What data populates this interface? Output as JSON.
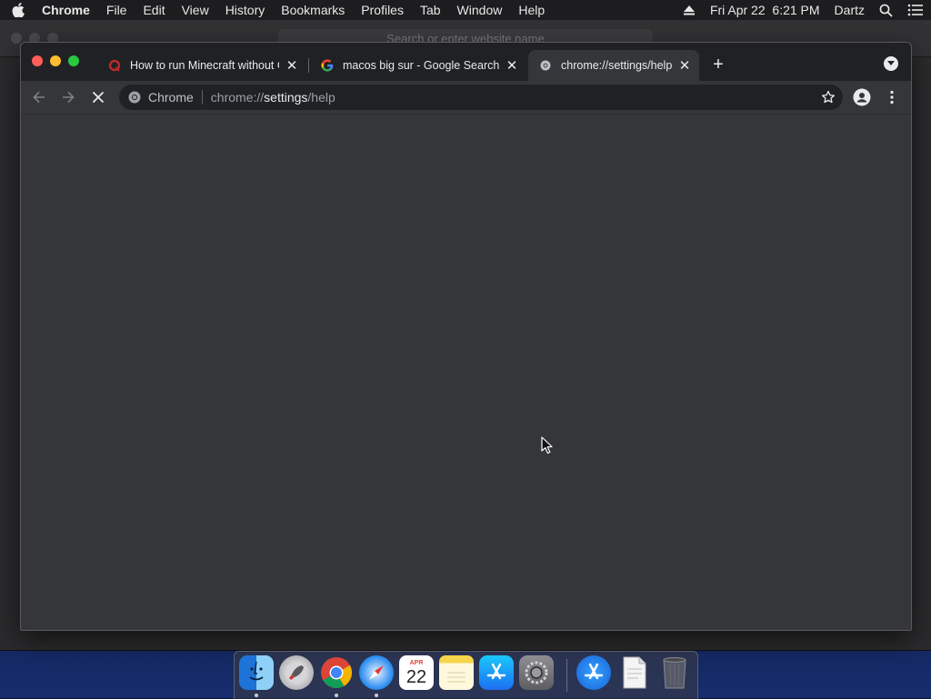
{
  "menubar": {
    "app_name": "Chrome",
    "menus": [
      "File",
      "Edit",
      "View",
      "History",
      "Bookmarks",
      "Profiles",
      "Tab",
      "Window",
      "Help"
    ],
    "clock": "Fri Apr 22  6:21 PM",
    "user": "Dartz"
  },
  "background_window": {
    "search_placeholder": "Search or enter website name"
  },
  "tabs": [
    {
      "title": "How to run Minecraft without C",
      "favicon": "quora-icon",
      "active": false
    },
    {
      "title": "macos big sur - Google Search",
      "favicon": "google-icon",
      "active": false
    },
    {
      "title": "chrome://settings/help",
      "favicon": "chrome-settings-icon",
      "active": true
    }
  ],
  "omnibox": {
    "chip_label": "Chrome",
    "url_prefix": "chrome://",
    "url_host": "settings",
    "url_path": "/help"
  },
  "dock": {
    "apps": [
      "Finder",
      "Launchpad",
      "Google Chrome",
      "Safari",
      "Calendar",
      "Notes",
      "App Store",
      "System Preferences",
      "App Store",
      "Document",
      "Trash"
    ],
    "calendar": {
      "month": "APR",
      "day": "22"
    }
  },
  "colors": {
    "tab_active": "#35363a",
    "window_bg": "#202124",
    "close_light": "#ff5f57",
    "min_light": "#febc2e",
    "max_light": "#28c840"
  }
}
